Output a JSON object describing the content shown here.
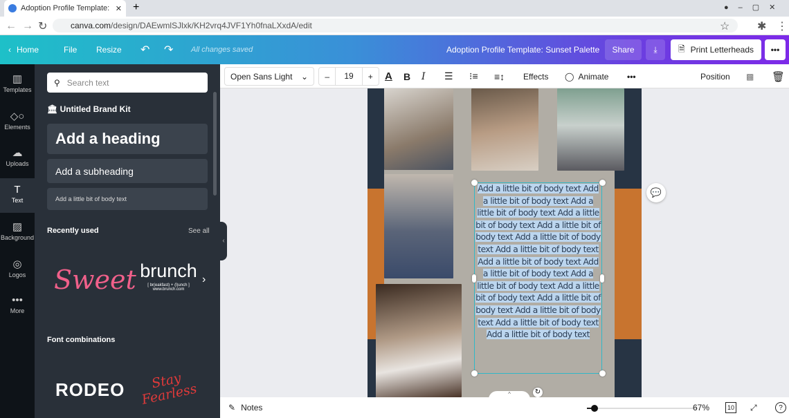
{
  "browser": {
    "tab_title": "Adoption Profile Template: Sunse",
    "url_host": "canva.com",
    "url_path": "/design/DAEwmlSJlxk/KH2vrq4JVF1Yh0fnaLXxdA/edit"
  },
  "topbar": {
    "home": "Home",
    "file": "File",
    "resize": "Resize",
    "status": "All changes saved",
    "doc_title": "Adoption Profile Template: Sunset Palette",
    "share": "Share",
    "print": "Print Letterheads"
  },
  "rail": [
    {
      "label": "Templates",
      "icon": "templates-icon"
    },
    {
      "label": "Elements",
      "icon": "elements-icon"
    },
    {
      "label": "Uploads",
      "icon": "uploads-icon"
    },
    {
      "label": "Text",
      "icon": "text-icon"
    },
    {
      "label": "Background",
      "icon": "background-icon"
    },
    {
      "label": "Logos",
      "icon": "logos-icon"
    },
    {
      "label": "More",
      "icon": "more-icon"
    }
  ],
  "panel": {
    "search_placeholder": "Search text",
    "brand_kit": "Untitled Brand Kit",
    "heading": "Add a heading",
    "subheading": "Add a subheading",
    "body": "Add a little bit of body text",
    "recent": "Recently used",
    "see_all": "See all",
    "sweet": "Sweet",
    "brunch": "brunch",
    "brunch_sub": "[ br(eakfast) + (l)unch ]",
    "brunch_url": "www.brunch.com",
    "font_combos": "Font combinations",
    "rodeo": "RODEO",
    "stay": "Stay Fearless"
  },
  "toolbar": {
    "font": "Open Sans Light",
    "size": "19",
    "effects": "Effects",
    "animate": "Animate",
    "position": "Position"
  },
  "canvas": {
    "body_text": "Add a little bit of body text Add a little bit of body text Add a little bit of body text Add a little bit of body text Add a little bit of body text Add a little bit of body text Add a little bit of body text Add a little bit of body text Add a little bit of body text Add a little bit of body text Add a little bit of body text Add a little bit of body text Add a little bit of body text Add a little bit of body text Add a little bit of body text"
  },
  "colors": {
    "navy": "#273444",
    "orange": "#c8742f",
    "gray": "#b1ada5",
    "accent": "#7d2ae8"
  },
  "footer": {
    "notes": "Notes",
    "zoom": "67%",
    "pages": "10",
    "zoom_level_percent": 67
  }
}
